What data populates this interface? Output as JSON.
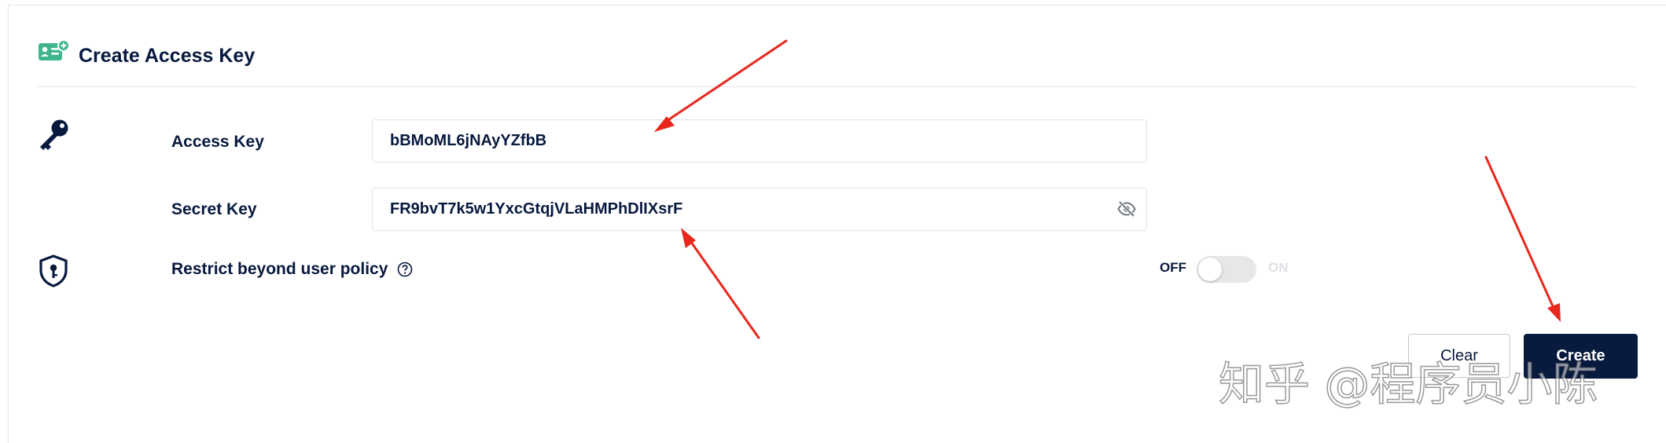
{
  "header": {
    "title": "Create Access Key",
    "icon": "id-card-add-icon"
  },
  "access_key": {
    "label": "Access Key",
    "value": "bBMoML6jNAyYZfbB",
    "icon": "key-icon"
  },
  "secret_key": {
    "label": "Secret Key",
    "value": "FR9bvT7k5w1YxcGtqjVLaHMPhDlIXsrF",
    "visibility_icon": "eye-off-icon"
  },
  "restrict_policy": {
    "label": "Restrict beyond user policy",
    "icon": "shield-key-icon",
    "help_icon": "question-circle-icon",
    "toggle": {
      "off_label": "OFF",
      "on_label": "ON",
      "state": "off"
    }
  },
  "actions": {
    "clear_label": "Clear",
    "create_label": "Create"
  },
  "watermark": "知乎 @程序员小陈",
  "colors": {
    "text": "#07193e",
    "primary_button": "#081a3e",
    "icon_accent": "#3fb68b",
    "annotation_arrow": "#e8281c"
  }
}
